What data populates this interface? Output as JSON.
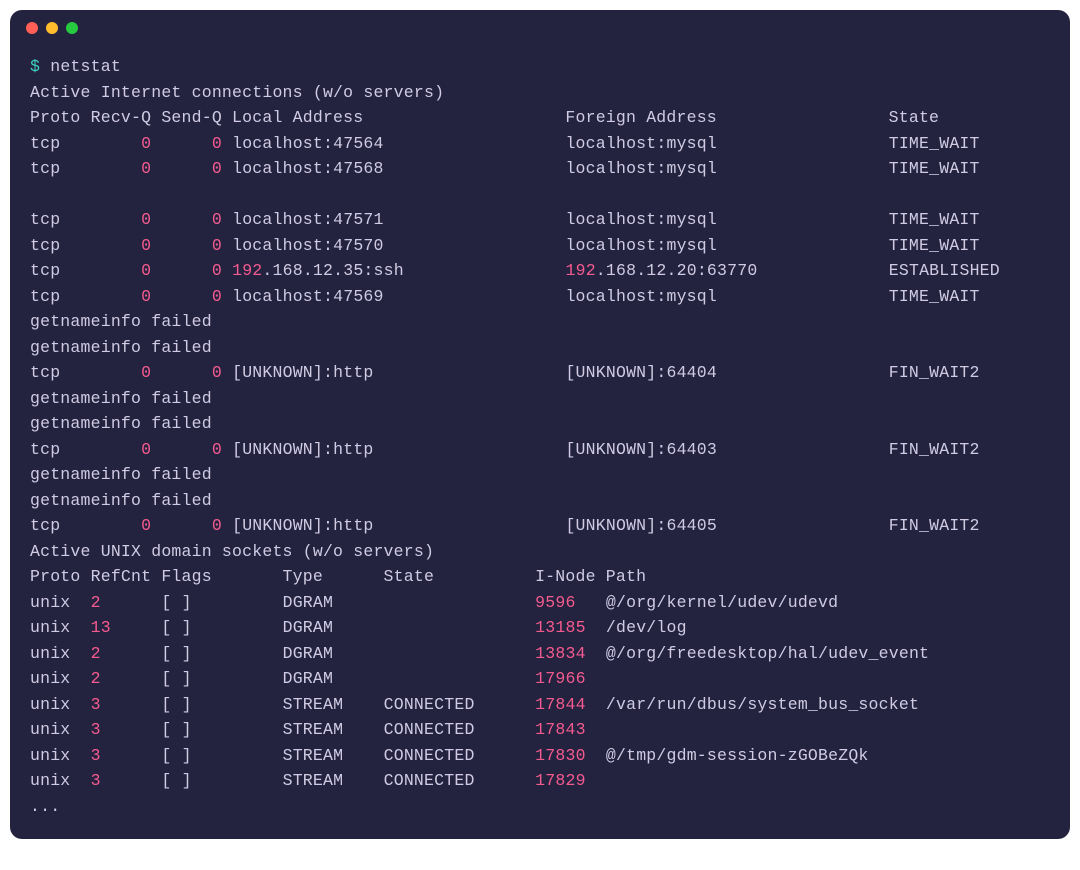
{
  "prompt": "$",
  "command": "netstat",
  "section1_title": "Active Internet connections (w/o servers)",
  "header1": {
    "proto": "Proto",
    "recvq": "Recv-Q",
    "sendq": "Send-Q",
    "local": "Local Address",
    "foreign": "Foreign Address",
    "state": "State"
  },
  "inet_rows": [
    {
      "proto": "tcp",
      "recvq": "0",
      "sendq": "0",
      "local": "localhost:47564",
      "foreign": "localhost:mysql",
      "state": "TIME_WAIT"
    },
    {
      "proto": "tcp",
      "recvq": "0",
      "sendq": "0",
      "local": "localhost:47568",
      "foreign": "localhost:mysql",
      "state": "TIME_WAIT"
    },
    {
      "blank": true
    },
    {
      "proto": "tcp",
      "recvq": "0",
      "sendq": "0",
      "local": "localhost:47571",
      "foreign": "localhost:mysql",
      "state": "TIME_WAIT"
    },
    {
      "proto": "tcp",
      "recvq": "0",
      "sendq": "0",
      "local": "localhost:47570",
      "foreign": "localhost:mysql",
      "state": "TIME_WAIT"
    },
    {
      "proto": "tcp",
      "recvq": "0",
      "sendq": "0",
      "local_ip": "192",
      "local_rest": ".168.12.35:ssh",
      "foreign_ip": "192",
      "foreign_rest": ".168.12.20:63770",
      "state": "ESTABLISHED"
    },
    {
      "proto": "tcp",
      "recvq": "0",
      "sendq": "0",
      "local": "localhost:47569",
      "foreign": "localhost:mysql",
      "state": "TIME_WAIT"
    },
    {
      "msg": "getnameinfo failed"
    },
    {
      "msg": "getnameinfo failed"
    },
    {
      "proto": "tcp",
      "recvq": "0",
      "sendq": "0",
      "local": "[UNKNOWN]:http",
      "foreign": "[UNKNOWN]:64404",
      "state": "FIN_WAIT2"
    },
    {
      "msg": "getnameinfo failed"
    },
    {
      "msg": "getnameinfo failed"
    },
    {
      "proto": "tcp",
      "recvq": "0",
      "sendq": "0",
      "local": "[UNKNOWN]:http",
      "foreign": "[UNKNOWN]:64403",
      "state": "FIN_WAIT2"
    },
    {
      "msg": "getnameinfo failed"
    },
    {
      "msg": "getnameinfo failed"
    },
    {
      "proto": "tcp",
      "recvq": "0",
      "sendq": "0",
      "local": "[UNKNOWN]:http",
      "foreign": "[UNKNOWN]:64405",
      "state": "FIN_WAIT2"
    }
  ],
  "section2_title": "Active UNIX domain sockets (w/o servers)",
  "header2": {
    "proto": "Proto",
    "refcnt": "RefCnt",
    "flags": "Flags",
    "type": "Type",
    "state": "State",
    "inode": "I-Node",
    "path": "Path"
  },
  "unix_rows": [
    {
      "proto": "unix",
      "refcnt": "2",
      "flags": "[ ]",
      "type": "DGRAM",
      "state": "",
      "inode": "9596",
      "path": "@/org/kernel/udev/udevd"
    },
    {
      "proto": "unix",
      "refcnt": "13",
      "flags": "[ ]",
      "type": "DGRAM",
      "state": "",
      "inode": "13185",
      "path": "/dev/log"
    },
    {
      "proto": "unix",
      "refcnt": "2",
      "flags": "[ ]",
      "type": "DGRAM",
      "state": "",
      "inode": "13834",
      "path": "@/org/freedesktop/hal/udev_event"
    },
    {
      "proto": "unix",
      "refcnt": "2",
      "flags": "[ ]",
      "type": "DGRAM",
      "state": "",
      "inode": "17966",
      "path": ""
    },
    {
      "proto": "unix",
      "refcnt": "3",
      "flags": "[ ]",
      "type": "STREAM",
      "state": "CONNECTED",
      "inode": "17844",
      "path": "/var/run/dbus/system_bus_socket"
    },
    {
      "proto": "unix",
      "refcnt": "3",
      "flags": "[ ]",
      "type": "STREAM",
      "state": "CONNECTED",
      "inode": "17843",
      "path": ""
    },
    {
      "proto": "unix",
      "refcnt": "3",
      "flags": "[ ]",
      "type": "STREAM",
      "state": "CONNECTED",
      "inode": "17830",
      "path": "@/tmp/gdm-session-zGOBeZQk"
    },
    {
      "proto": "unix",
      "refcnt": "3",
      "flags": "[ ]",
      "type": "STREAM",
      "state": "CONNECTED",
      "inode": "17829",
      "path": ""
    }
  ],
  "ellipsis": "..."
}
